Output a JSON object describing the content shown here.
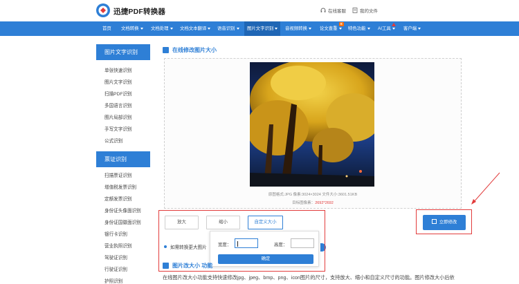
{
  "header": {
    "brand": "迅捷PDF转换器",
    "service_label": "在线客服",
    "files_label": "我的文件"
  },
  "nav": {
    "items": [
      {
        "label": "首页",
        "caret": false
      },
      {
        "label": "文档转换",
        "caret": true
      },
      {
        "label": "文档处理",
        "caret": true
      },
      {
        "label": "文档文本翻译",
        "caret": true
      },
      {
        "label": "语音识别",
        "caret": true
      },
      {
        "label": "图片文字识别",
        "caret": true,
        "active": true
      },
      {
        "label": "音视频转换",
        "caret": true
      },
      {
        "label": "论文查重",
        "caret": true
      },
      {
        "label": "特色功能",
        "caret": true
      },
      {
        "label": "AI工具",
        "caret": true
      },
      {
        "label": "客户端",
        "caret": true
      }
    ],
    "badge": "新"
  },
  "sidebar": {
    "group1": {
      "title": "图片文字识别",
      "items": [
        "单张快速识别",
        "图片文字识别",
        "扫描PDF识别",
        "多国语言识别",
        "图片局部识别",
        "手写文字识别",
        "公式识别"
      ]
    },
    "group2": {
      "title": "票证识别",
      "items": [
        "扫描票证识别",
        "增值税发票识别",
        "定额发票识别",
        "身份证头像面识别",
        "身份证国徽面识别",
        "银行卡识别",
        "营业执照识别",
        "驾驶证识别",
        "行驶证识别",
        "护照识别"
      ]
    }
  },
  "main": {
    "title": "在线修改图片大小",
    "meta_line1": "原图格式:JPG 像素:3024×3024 文件大小:3601.51KB",
    "meta_line2_label": "目标图像素：",
    "meta_line2_value": "2692*2692",
    "tools": {
      "enlarge": "放大",
      "shrink": "缩小",
      "custom": "自定义大小"
    },
    "apply": "立即修改",
    "popup": {
      "width_label": "宽度：",
      "height_label": "高度：",
      "confirm": "确定"
    },
    "bullet": "如需转换更大图片",
    "section2_title": "图片改大小 功能",
    "paragraph": "在线图片改大小功能支持快速修改jpg、jpeg、bmp、png、icon图片的尺寸，支持放大、缩小和自定义尺寸的功能。图片修改大小后依"
  },
  "colors": {
    "primary": "#2e7fd6",
    "nav_active": "#1f66b5",
    "highlight_red": "#e23b3b"
  }
}
